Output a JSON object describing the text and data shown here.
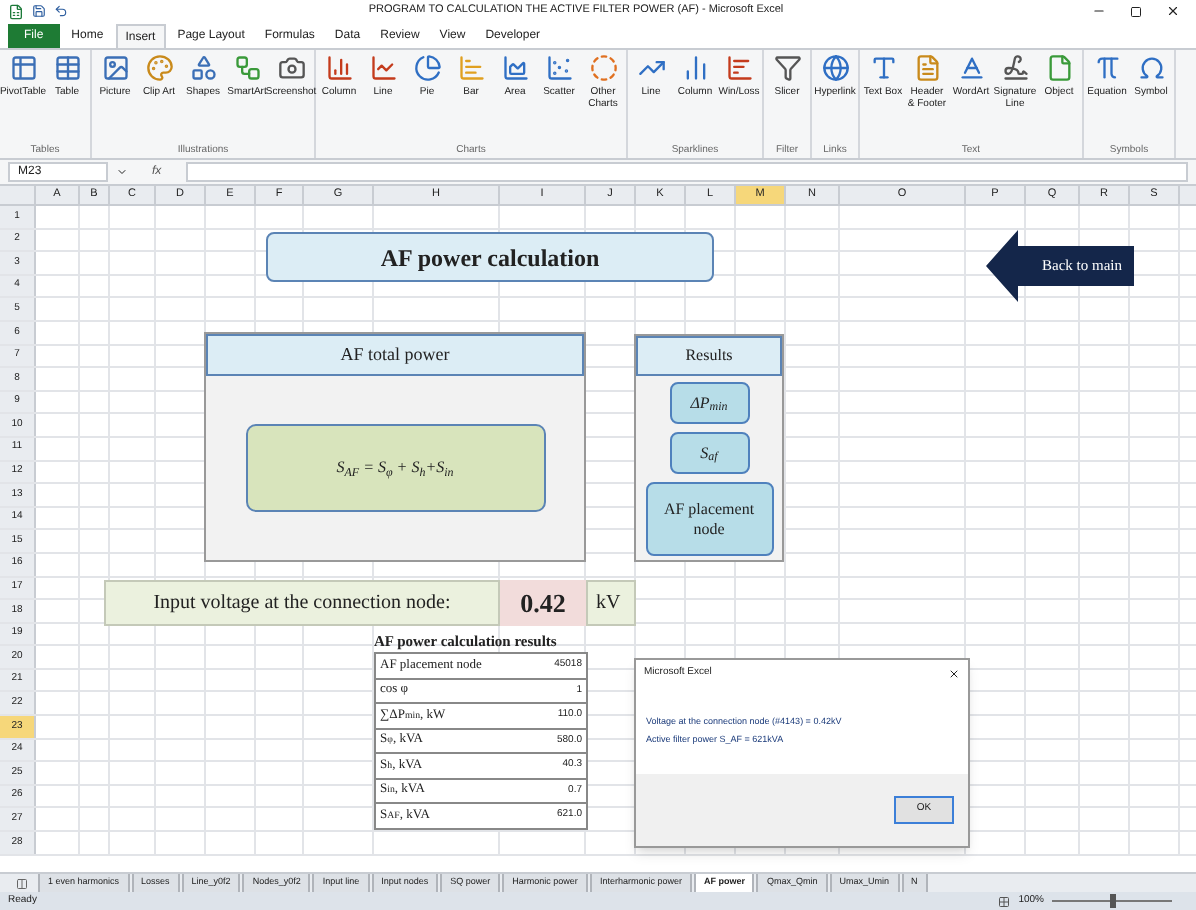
{
  "window": {
    "title": "PROGRAM TO CALCULATION THE ACTIVE FILTER POWER (AF) - Microsoft Excel"
  },
  "menu_tabs": [
    {
      "label": "File",
      "selected": false,
      "kind": "file"
    },
    {
      "label": "Home",
      "selected": false,
      "kind": "tab"
    },
    {
      "label": "Insert",
      "selected": true,
      "kind": "tab"
    },
    {
      "label": "Page Layout",
      "selected": false,
      "kind": "tab"
    },
    {
      "label": "Formulas",
      "selected": false,
      "kind": "tab"
    },
    {
      "label": "Data",
      "selected": false,
      "kind": "tab"
    },
    {
      "label": "Review",
      "selected": false,
      "kind": "tab"
    },
    {
      "label": "View",
      "selected": false,
      "kind": "tab"
    },
    {
      "label": "Developer",
      "selected": false,
      "kind": "tab"
    }
  ],
  "ribbon": {
    "groups": [
      {
        "label": "Tables",
        "buttons": [
          "PivotTable",
          "Table"
        ]
      },
      {
        "label": "Illustrations",
        "buttons": [
          "Picture",
          "Clip Art",
          "Shapes",
          "SmartArt",
          "Screenshot"
        ]
      },
      {
        "label": "Charts",
        "buttons": [
          "Column",
          "Line",
          "Pie",
          "Bar",
          "Area",
          "Scatter",
          "Other Charts"
        ]
      },
      {
        "label": "Sparklines",
        "buttons": [
          "Line",
          "Column",
          "Win/Loss"
        ]
      },
      {
        "label": "Filter",
        "buttons": [
          "Slicer"
        ]
      },
      {
        "label": "Links",
        "buttons": [
          "Hyperlink"
        ]
      },
      {
        "label": "Text",
        "buttons": [
          "Text Box",
          "Header & Footer",
          "WordArt",
          "Signature Line",
          "Object"
        ]
      },
      {
        "label": "Symbols",
        "buttons": [
          "Equation",
          "Symbol"
        ]
      }
    ]
  },
  "formula_bar": {
    "name_box": "M23",
    "fx": "fx"
  },
  "columns": [
    {
      "label": "A",
      "selected": false
    },
    {
      "label": "B",
      "selected": false
    },
    {
      "label": "C",
      "selected": false
    },
    {
      "label": "D",
      "selected": false
    },
    {
      "label": "E",
      "selected": false
    },
    {
      "label": "F",
      "selected": false
    },
    {
      "label": "G",
      "selected": false
    },
    {
      "label": "H",
      "selected": false
    },
    {
      "label": "I",
      "selected": false
    },
    {
      "label": "J",
      "selected": false
    },
    {
      "label": "K",
      "selected": false
    },
    {
      "label": "L",
      "selected": false
    },
    {
      "label": "M",
      "selected": true
    },
    {
      "label": "N",
      "selected": false
    },
    {
      "label": "O",
      "selected": false
    },
    {
      "label": "P",
      "selected": false
    },
    {
      "label": "Q",
      "selected": false
    },
    {
      "label": "R",
      "selected": false
    },
    {
      "label": "S",
      "selected": false
    }
  ],
  "rows": [
    {
      "label": "1",
      "selected": false
    },
    {
      "label": "2",
      "selected": false
    },
    {
      "label": "3",
      "selected": false
    },
    {
      "label": "4",
      "selected": false
    },
    {
      "label": "5",
      "selected": false
    },
    {
      "label": "6",
      "selected": false
    },
    {
      "label": "7",
      "selected": false
    },
    {
      "label": "8",
      "selected": false
    },
    {
      "label": "9",
      "selected": false
    },
    {
      "label": "10",
      "selected": false
    },
    {
      "label": "11",
      "selected": false
    },
    {
      "label": "12",
      "selected": false
    },
    {
      "label": "13",
      "selected": false
    },
    {
      "label": "14",
      "selected": false
    },
    {
      "label": "15",
      "selected": false
    },
    {
      "label": "16",
      "selected": false
    },
    {
      "label": "17",
      "selected": false
    },
    {
      "label": "18",
      "selected": false
    },
    {
      "label": "19",
      "selected": false
    },
    {
      "label": "20",
      "selected": false
    },
    {
      "label": "21",
      "selected": false
    },
    {
      "label": "22",
      "selected": false
    },
    {
      "label": "23",
      "selected": true
    },
    {
      "label": "24",
      "selected": false
    },
    {
      "label": "25",
      "selected": false
    },
    {
      "label": "26",
      "selected": false
    },
    {
      "label": "27",
      "selected": false
    },
    {
      "label": "28",
      "selected": false
    }
  ],
  "sheet": {
    "title": "AF power calculation",
    "back_button": "Back to main",
    "total_power": {
      "title": "AF total power",
      "formula": "S$_{AF}$ = S$_{φ}$ + S$_{h}$+S$_{in}$"
    },
    "results": {
      "title": "Results",
      "buttons": [
        "ΔP$_{min}$",
        "S$_{af}$",
        "AF placement node"
      ]
    },
    "voltage": {
      "label": "Input voltage at the connection node:",
      "value": "0.42",
      "unit": "kV"
    },
    "results_table": {
      "title": "AF power calculation results",
      "rows": [
        {
          "label": "AF placement node",
          "value": "45018"
        },
        {
          "label": "cos φ",
          "value": "1"
        },
        {
          "label": "∑ΔP$_{min}$, kW",
          "value": "110.0"
        },
        {
          "label": "S$_{φ}$, kVA",
          "value": "580.0"
        },
        {
          "label": "S$_{h}$, kVA",
          "value": "40.3"
        },
        {
          "label": "S$_{in}$, kVA",
          "value": "0.7"
        },
        {
          "label": "S$_{AF}$, kVA",
          "value": "621.0"
        }
      ]
    }
  },
  "dialog": {
    "title": "Microsoft Excel",
    "lines": [
      "Voltage at the connection node (#4143) = 0.42kV",
      "Active filter power S_AF = 621kVA"
    ],
    "button": "OK"
  },
  "sheet_tabs": [
    {
      "label": "1 even harmonics",
      "selected": false
    },
    {
      "label": "Losses",
      "selected": false
    },
    {
      "label": "Line_y0f2",
      "selected": false
    },
    {
      "label": "Nodes_y0f2",
      "selected": false
    },
    {
      "label": "Input line",
      "selected": false
    },
    {
      "label": "Input nodes",
      "selected": false
    },
    {
      "label": "SQ power",
      "selected": false
    },
    {
      "label": "Harmonic power",
      "selected": false
    },
    {
      "label": "Interharmonic power",
      "selected": false
    },
    {
      "label": "AF power",
      "selected": true
    },
    {
      "label": "Qmax_Qmin",
      "selected": false
    },
    {
      "label": "Umax_Umin",
      "selected": false
    },
    {
      "label": "N",
      "selected": false
    }
  ],
  "status_bar": {
    "status": "Ready",
    "zoom": "100%",
    "zoom_slider": {
      "level": 0.5
    }
  }
}
